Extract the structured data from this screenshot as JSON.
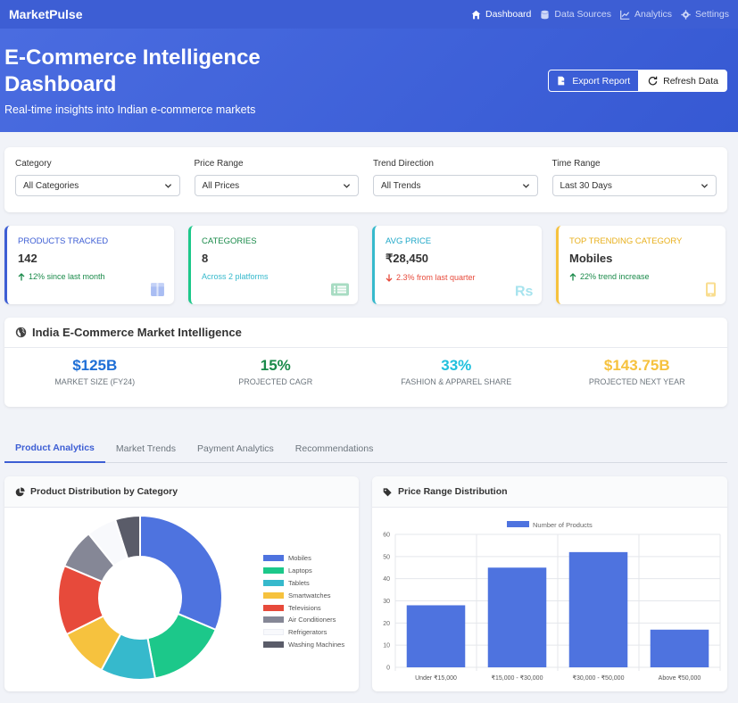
{
  "nav": {
    "brand": "MarketPulse",
    "links": [
      {
        "label": "Dashboard",
        "icon": "home-icon"
      },
      {
        "label": "Data Sources",
        "icon": "database-icon"
      },
      {
        "label": "Analytics",
        "icon": "chart-line-icon"
      },
      {
        "label": "Settings",
        "icon": "gear-icon"
      }
    ]
  },
  "hero": {
    "title": "E-Commerce Intelligence Dashboard",
    "subtitle": "Real-time insights into Indian e-commerce markets",
    "export_label": "Export Report",
    "refresh_label": "Refresh Data"
  },
  "filters": [
    {
      "label": "Category",
      "value": "All Categories"
    },
    {
      "label": "Price Range",
      "value": "All Prices"
    },
    {
      "label": "Trend Direction",
      "value": "All Trends"
    },
    {
      "label": "Time Range",
      "value": "Last 30 Days"
    }
  ],
  "stats": [
    {
      "label": "PRODUCTS TRACKED",
      "value": "142",
      "sub": "12% since last month",
      "color": "#3d5ed4",
      "sub_color": "#1a8a4a",
      "icon": "box-icon"
    },
    {
      "label": "CATEGORIES",
      "value": "8",
      "sub": "Across 2 platforms",
      "color": "#1cc88a",
      "sub_color": "#36b9cc",
      "icon": "list-icon"
    },
    {
      "label": "AVG PRICE",
      "value": "₹28,450",
      "sub": "2.3% from last quarter",
      "color": "#36b9cc",
      "sub_color": "#e74a3b",
      "icon": "rupee-icon"
    },
    {
      "label": "TOP TRENDING CATEGORY",
      "value": "Mobiles",
      "sub": "22% trend increase",
      "color": "#f6c23e",
      "sub_color": "#1a8a4a",
      "icon": "mobile-icon"
    }
  ],
  "market": {
    "title": "India E-Commerce Market Intelligence",
    "metrics": [
      {
        "value": "$125B",
        "label": "MARKET SIZE (FY24)",
        "color": "#1f6fd6"
      },
      {
        "value": "15%",
        "label": "PROJECTED CAGR",
        "color": "#1a8a4a"
      },
      {
        "value": "33%",
        "label": "FASHION & APPAREL SHARE",
        "color": "#20c0dd"
      },
      {
        "value": "$143.75B",
        "label": "PROJECTED NEXT YEAR",
        "color": "#f6c23e"
      }
    ]
  },
  "tabs": [
    "Product Analytics",
    "Market Trends",
    "Payment Analytics",
    "Recommendations"
  ],
  "charts": {
    "left_title": "Product Distribution by Category",
    "right_title": "Price Range Distribution"
  },
  "chart_data": [
    {
      "type": "pie",
      "variant": "doughnut",
      "title": "Product Distribution by Category",
      "legend_position": "right",
      "categories": [
        "Mobiles",
        "Laptops",
        "Tablets",
        "Smartwatches",
        "Televisions",
        "Air Conditioners",
        "Refrigerators",
        "Washing Machines"
      ],
      "values": [
        32,
        16,
        11,
        10,
        14,
        8,
        6,
        5
      ],
      "colors": [
        "#4e73df",
        "#1cc88a",
        "#36b9cc",
        "#f6c23e",
        "#e74a3b",
        "#858796",
        "#f8f9fc",
        "#5a5c69"
      ]
    },
    {
      "type": "bar",
      "title": "Price Range Distribution",
      "categories": [
        "Under ₹15,000",
        "₹15,000 - ₹30,000",
        "₹30,000 - ₹50,000",
        "Above ₹50,000"
      ],
      "series": [
        {
          "name": "Number of Products",
          "values": [
            28,
            45,
            52,
            17
          ]
        }
      ],
      "ylim": [
        0,
        60
      ],
      "yticks": [
        0,
        10,
        20,
        30,
        40,
        50,
        60
      ],
      "grid": true,
      "legend_position": "top",
      "color": "#4e73df"
    }
  ]
}
